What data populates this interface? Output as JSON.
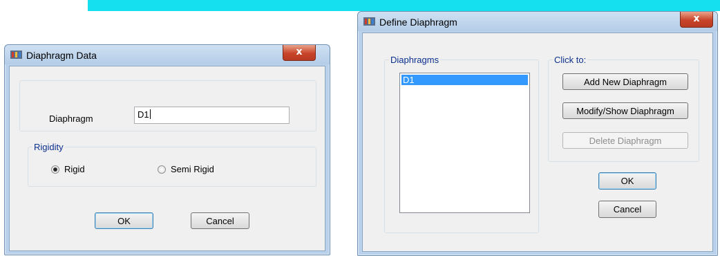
{
  "banner": {
    "color": "#14e0f0"
  },
  "diaphragm_data": {
    "title": "Diaphragm Data",
    "close_label": "x",
    "diaphragm_label": "Diaphragm",
    "diaphragm_value": "D1",
    "rigidity_label": "Rigidity",
    "rigid_label": "Rigid",
    "semi_rigid_label": "Semi Rigid",
    "selected_rigidity": "Rigid",
    "ok_label": "OK",
    "cancel_label": "Cancel"
  },
  "define_diaphragm": {
    "title": "Define Diaphragm",
    "close_label": "x",
    "diaphragms_label": "Diaphragms",
    "diaphragms": [
      "D1"
    ],
    "selected_diaphragm": "D1",
    "click_to_label": "Click to:",
    "add_label": "Add New Diaphragm",
    "modify_label": "Modify/Show Diaphragm",
    "delete_label": "Delete Diaphragm",
    "ok_label": "OK",
    "cancel_label": "Cancel"
  },
  "colors": {
    "selection": "#3399ff",
    "group_label": "#0b2f8f",
    "close_button": "#c8452a"
  }
}
